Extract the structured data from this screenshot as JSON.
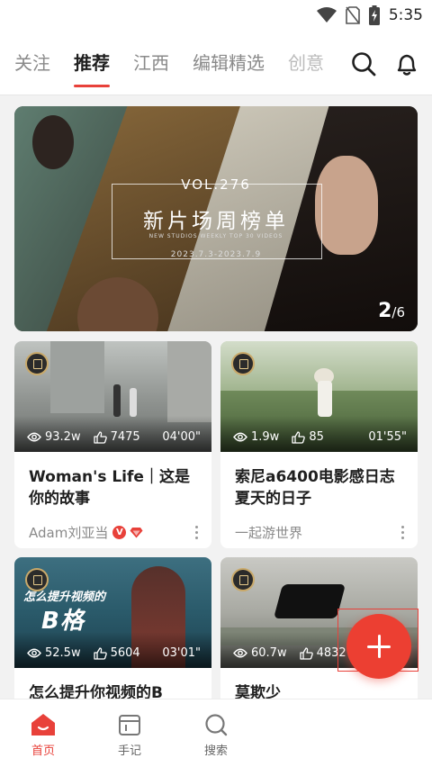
{
  "status_bar": {
    "time": "5:35"
  },
  "top_tabs": [
    "关注",
    "推荐",
    "江西",
    "编辑精选",
    "创意"
  ],
  "active_tab_index": 1,
  "hero": {
    "volume": "VOL.276",
    "title": "新片场周榜单",
    "subtitle": "NEW STUDIOS WEEKLY TOP 30 VIDEOS",
    "date_range": "2023.7.3-2023.7.9",
    "current_page": "2",
    "total_pages": "6"
  },
  "cards": [
    {
      "views": "93.2w",
      "likes": "7475",
      "duration": "04'00\"",
      "title": "Woman's Life｜这是你的故事",
      "author": "Adam刘亚当",
      "verified_badge": "V"
    },
    {
      "views": "1.9w",
      "likes": "85",
      "duration": "01'55\"",
      "title": "索尼a6400电影感日志夏天的日子",
      "author": "一起游世界"
    },
    {
      "thumb_text_top": "怎么提升视频的",
      "thumb_text_big": "B格",
      "views": "52.5w",
      "likes": "5604",
      "duration": "03'01\"",
      "title": "怎么提升你视频的B"
    },
    {
      "views": "60.7w",
      "likes": "4832",
      "duration": "",
      "title": "莫欺少"
    }
  ],
  "bottom_nav": [
    "首页",
    "手记",
    "搜索"
  ],
  "colors": {
    "accent": "#e8413a"
  }
}
